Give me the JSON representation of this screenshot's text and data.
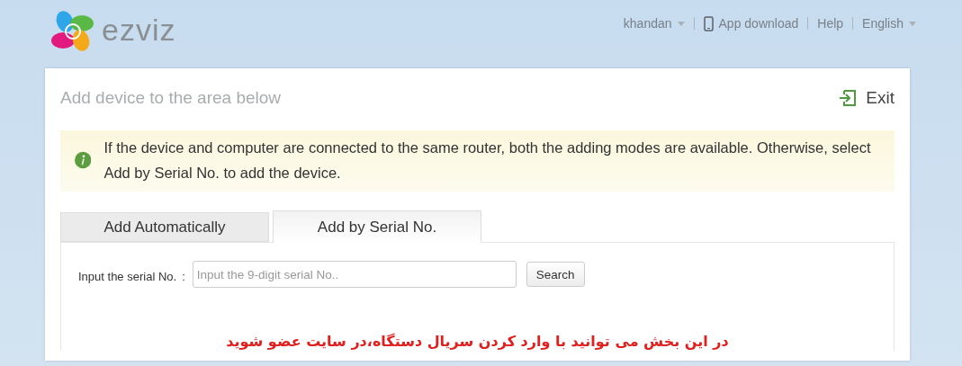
{
  "header": {
    "logo": "ezviz",
    "user": "khandan",
    "links": [
      {
        "kind": "app",
        "label": "App download"
      },
      {
        "kind": "plain",
        "label": "Help"
      },
      {
        "kind": "menu",
        "label": "English"
      }
    ]
  },
  "page": {
    "title": "Add device to the area below",
    "exit": "Exit"
  },
  "notice": "If the device and computer are connected to the same router, both the adding modes are available. Otherwise, select Add by Serial No. to add the device.",
  "tabs": [
    {
      "label": "Add Automatically",
      "selected": false
    },
    {
      "label": "Add by Serial No.",
      "selected": true
    }
  ],
  "serial": {
    "label": "Input the serial No.",
    "separator": ":",
    "placeholder": "Input the 9-digit serial No..",
    "button": "Search"
  },
  "note": "در این بخش می توانید با وارد کردن سریال دستگاه،در سایت عضو شوید"
}
